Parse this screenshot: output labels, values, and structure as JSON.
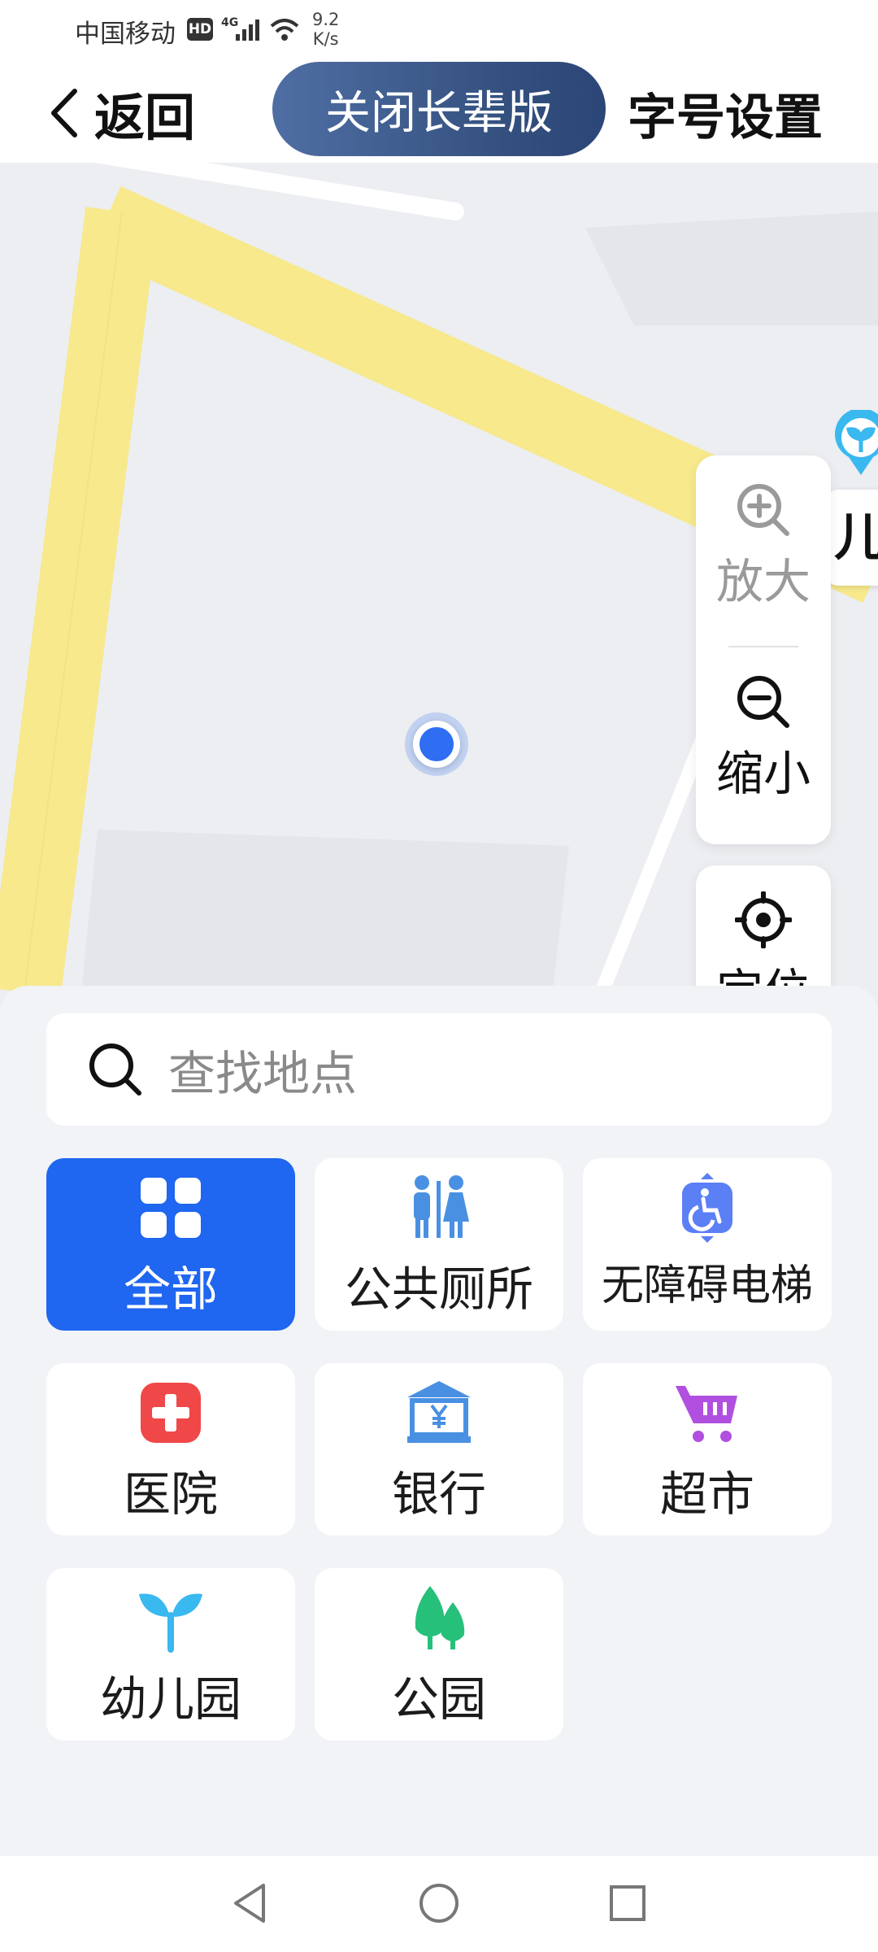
{
  "status_bar": {
    "carrier": "中国移动",
    "hd": "HD",
    "network": "4G",
    "speed_value": "9.2",
    "speed_unit": "K/s"
  },
  "header": {
    "back_label": "返回",
    "elder_mode_label": "关闭长辈版",
    "font_settings_label": "字号设置"
  },
  "map": {
    "poi_label_partial": "儿"
  },
  "controls": {
    "zoom_in": "放大",
    "zoom_out": "缩小",
    "locate": "定位"
  },
  "search": {
    "placeholder": "查找地点"
  },
  "categories": [
    {
      "label": "全部",
      "icon": "grid-icon",
      "active": true
    },
    {
      "label": "公共厕所",
      "icon": "toilet-icon",
      "active": false
    },
    {
      "label": "无障碍电梯",
      "icon": "accessible-elevator-icon",
      "active": false
    },
    {
      "label": "医院",
      "icon": "hospital-icon",
      "active": false
    },
    {
      "label": "银行",
      "icon": "bank-icon",
      "active": false
    },
    {
      "label": "超市",
      "icon": "cart-icon",
      "active": false
    },
    {
      "label": "幼儿园",
      "icon": "sprout-icon",
      "active": false
    },
    {
      "label": "公园",
      "icon": "tree-icon",
      "active": false
    }
  ],
  "colors": {
    "accent": "#1f66f0",
    "elder_toggle": "#3c5787",
    "road_yellow": "#f7e98c",
    "hospital_red": "#f04848",
    "icon_blue": "#4a90e2",
    "cart_purple": "#b04fe0",
    "park_green": "#27c07a"
  }
}
